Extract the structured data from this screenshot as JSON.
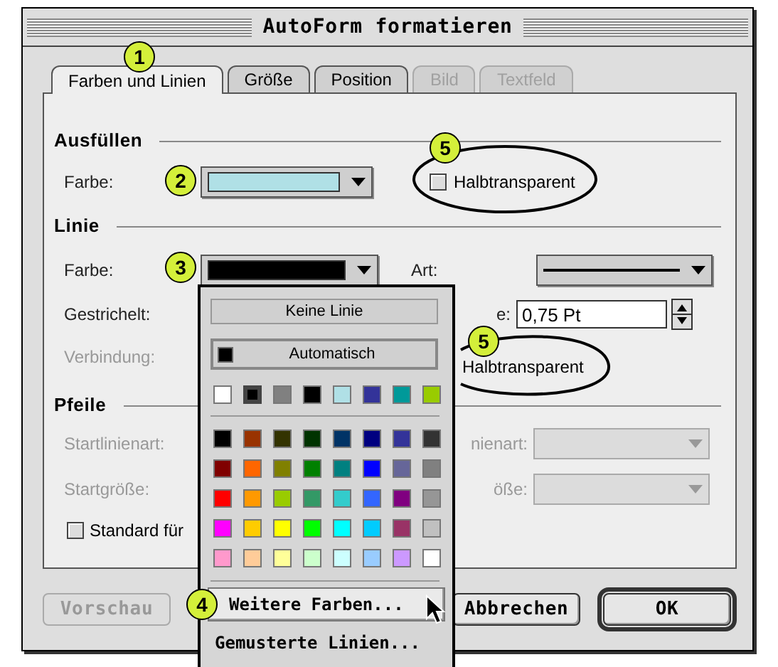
{
  "window": {
    "title": "AutoForm formatieren"
  },
  "tabs": [
    {
      "label": "Farben und Linien",
      "selected": true,
      "disabled": false
    },
    {
      "label": "Größe",
      "selected": false,
      "disabled": false
    },
    {
      "label": "Position",
      "selected": false,
      "disabled": false
    },
    {
      "label": "Bild",
      "selected": false,
      "disabled": true
    },
    {
      "label": "Textfeld",
      "selected": false,
      "disabled": true
    }
  ],
  "fill": {
    "heading": "Ausfüllen",
    "color_label": "Farbe:",
    "color": "#b0e0e6",
    "semi_transparent": {
      "label": "Halbtransparent",
      "checked": false
    }
  },
  "line": {
    "heading": "Linie",
    "color_label": "Farbe:",
    "color": "#000000",
    "style_label": "Art:",
    "dash_label": "Gestrichelt:",
    "weight_label": "e:",
    "weight_value": "0,75 Pt",
    "join": {
      "label": "Verbindung:",
      "disabled": true
    },
    "semi_transparent_label": "Halbtransparent"
  },
  "arrows": {
    "heading": "Pfeile",
    "begin_style": {
      "label": "Startlinienart:",
      "disabled": true
    },
    "end_style": {
      "label": "nienart:",
      "disabled": true
    },
    "begin_size": {
      "label": "Startgröße:",
      "disabled": true
    },
    "end_size": {
      "label": "öße:",
      "disabled": true
    },
    "default_checkbox": {
      "label": "Standard für",
      "checked": false
    }
  },
  "buttons": [
    {
      "label": "Vorschau",
      "disabled": true,
      "default": false
    },
    {
      "label": "Abbrechen",
      "disabled": false,
      "default": false
    },
    {
      "label": "OK",
      "disabled": false,
      "default": true
    }
  ],
  "color_popup": {
    "no_line": "Keine Linie",
    "automatic": "Automatisch",
    "recent_colors": [
      {
        "color": "#ffffff",
        "selected": false
      },
      {
        "color": "#000000",
        "selected": true
      },
      {
        "color": "#808080",
        "selected": false
      },
      {
        "color": "#000000",
        "selected": false
      },
      {
        "color": "#b0e0e6",
        "selected": false
      },
      {
        "color": "#333399",
        "selected": false
      },
      {
        "color": "#009999",
        "selected": false
      },
      {
        "color": "#99cc00",
        "selected": false
      }
    ],
    "palette": [
      {
        "color": "#000000"
      },
      {
        "color": "#993300"
      },
      {
        "color": "#333300"
      },
      {
        "color": "#003300"
      },
      {
        "color": "#003366"
      },
      {
        "color": "#000080"
      },
      {
        "color": "#333399"
      },
      {
        "color": "#333333"
      },
      {
        "color": "#800000"
      },
      {
        "color": "#ff6600"
      },
      {
        "color": "#808000"
      },
      {
        "color": "#008000"
      },
      {
        "color": "#008080"
      },
      {
        "color": "#0000ff"
      },
      {
        "color": "#666699"
      },
      {
        "color": "#808080"
      },
      {
        "color": "#ff0000"
      },
      {
        "color": "#ff9900"
      },
      {
        "color": "#99cc00"
      },
      {
        "color": "#339966"
      },
      {
        "color": "#33cccc"
      },
      {
        "color": "#3366ff"
      },
      {
        "color": "#800080"
      },
      {
        "color": "#969696"
      },
      {
        "color": "#ff00ff"
      },
      {
        "color": "#ffcc00"
      },
      {
        "color": "#ffff00"
      },
      {
        "color": "#00ff00"
      },
      {
        "color": "#00ffff"
      },
      {
        "color": "#00ccff"
      },
      {
        "color": "#993366"
      },
      {
        "color": "#c0c0c0"
      },
      {
        "color": "#ff99cc"
      },
      {
        "color": "#ffcc99"
      },
      {
        "color": "#ffff99"
      },
      {
        "color": "#ccffcc"
      },
      {
        "color": "#ccffff"
      },
      {
        "color": "#99ccff"
      },
      {
        "color": "#cc99ff"
      },
      {
        "color": "#ffffff"
      }
    ],
    "more_colors": {
      "label": "Weitere Farben...",
      "highlighted": true
    },
    "patterned_lines": "Gemusterte Linien..."
  },
  "callouts": [
    "1",
    "2",
    "3",
    "4",
    "5",
    "5"
  ]
}
